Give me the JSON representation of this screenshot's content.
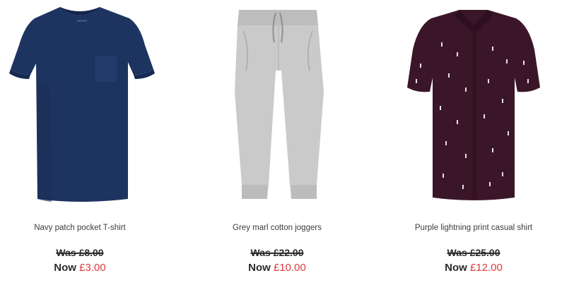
{
  "colors": {
    "sale_price": "#dd3b3b",
    "text": "#3d3d3d",
    "navy_tshirt": "#1e3460",
    "grey_joggers": "#c9c9c9",
    "purple_shirt": "#3b1628"
  },
  "products": [
    {
      "name": "Navy patch pocket T-shirt",
      "image_icon": "navy-tshirt-image",
      "was_price": "Was £8.00",
      "now_label": "Now",
      "now_price": "£3.00"
    },
    {
      "name": "Grey marl cotton joggers",
      "image_icon": "grey-joggers-image",
      "was_price": "Was £22.00",
      "now_label": "Now",
      "now_price": "£10.00"
    },
    {
      "name": "Purple lightning print casual shirt",
      "image_icon": "purple-shirt-image",
      "was_price": "Was £25.00",
      "now_label": "Now",
      "now_price": "£12.00"
    }
  ]
}
